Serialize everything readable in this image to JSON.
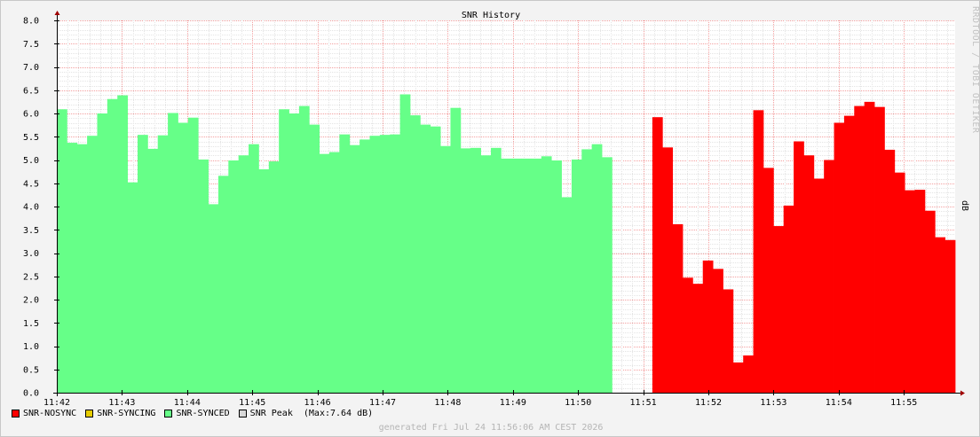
{
  "chart_data": {
    "type": "area",
    "title": "SNR History",
    "ylabel": "dB",
    "watermark": "RRDTOOL / TOBI OETIKER",
    "ylim": [
      0,
      8
    ],
    "yticks": [
      "0.0",
      "0.5",
      "1.0",
      "1.5",
      "2.0",
      "2.5",
      "3.0",
      "3.5",
      "4.0",
      "4.5",
      "5.0",
      "5.5",
      "6.0",
      "6.5",
      "7.0",
      "7.5",
      "8.0"
    ],
    "xticks": [
      "11:42",
      "11:43",
      "11:44",
      "11:45",
      "11:46",
      "11:47",
      "11:48",
      "11:49",
      "11:50",
      "11:51",
      "11:52",
      "11:53",
      "11:54",
      "11:55"
    ],
    "grid": true,
    "legend_position": "bottom-left",
    "series": [
      {
        "name": "SNR-NOSYNC",
        "color": "#ff0000",
        "values": [
          null,
          null,
          null,
          null,
          null,
          null,
          null,
          null,
          null,
          null,
          null,
          null,
          null,
          null,
          null,
          null,
          null,
          null,
          null,
          null,
          null,
          null,
          null,
          null,
          null,
          null,
          null,
          null,
          null,
          null,
          null,
          null,
          null,
          null,
          null,
          null,
          null,
          null,
          null,
          null,
          null,
          null,
          null,
          null,
          null,
          null,
          null,
          null,
          null,
          null,
          null,
          null,
          null,
          null,
          null,
          null,
          null,
          null,
          null,
          5.92,
          5.27,
          3.62,
          2.47,
          2.34,
          2.84,
          2.66,
          2.22,
          0.65,
          0.8,
          6.07,
          4.83,
          3.58,
          4.02,
          5.4,
          5.1,
          4.6,
          5.0,
          5.8,
          5.95,
          6.16,
          6.25,
          6.14,
          5.22,
          4.73,
          4.35,
          4.36,
          3.91,
          3.34,
          3.28
        ]
      },
      {
        "name": "SNR-SYNCING",
        "color": "#e6cc00",
        "values": []
      },
      {
        "name": "SNR-SYNCED",
        "color": "#66ff88",
        "values": [
          6.09,
          5.37,
          5.34,
          5.52,
          6.0,
          6.31,
          6.39,
          4.52,
          5.54,
          5.24,
          5.53,
          6.01,
          5.8,
          5.91,
          5.01,
          4.05,
          4.66,
          4.99,
          5.1,
          5.34,
          4.8,
          4.97,
          6.09,
          6.0,
          6.16,
          5.76,
          5.13,
          5.17,
          5.55,
          5.32,
          5.44,
          5.52,
          5.54,
          5.55,
          6.41,
          5.96,
          5.76,
          5.72,
          5.3,
          6.12,
          5.25,
          5.26,
          5.1,
          5.26,
          5.03,
          5.03,
          5.03,
          5.03,
          5.08,
          4.99,
          4.2,
          5.01,
          5.23,
          5.34,
          5.06,
          null,
          null,
          null,
          null,
          null,
          null,
          null,
          null,
          null,
          null,
          null,
          null,
          null,
          null,
          null,
          null,
          null,
          null,
          null,
          null,
          null,
          null,
          null,
          null,
          null,
          null,
          null,
          null,
          null,
          null,
          null,
          null,
          null,
          null
        ]
      }
    ],
    "peak": {
      "name": "SNR Peak",
      "label": "  (Max:7.64 dB)",
      "value": 7.64,
      "color": "#d8d8d8"
    }
  },
  "footer": "generated Fri Jul 24 11:56:06 AM CEST 2026"
}
